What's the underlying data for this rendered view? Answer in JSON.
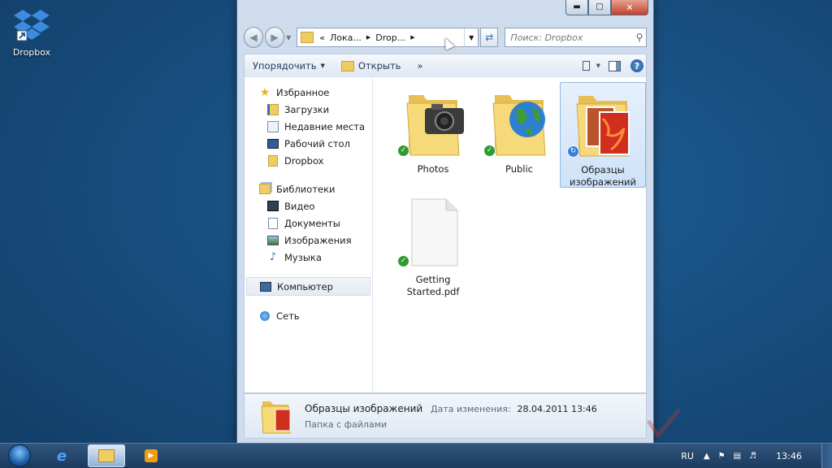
{
  "desktop": {
    "icon_label": "Dropbox"
  },
  "window": {
    "address": {
      "prefix": "«",
      "crumbs": [
        "Лока...",
        "Drop..."
      ]
    },
    "search_placeholder": "Поиск: Dropbox",
    "toolbar": {
      "organize": "Упорядочить",
      "open": "Открыть",
      "more": "»"
    },
    "navpane": {
      "favorites": {
        "title": "Избранное",
        "items": [
          "Загрузки",
          "Недавние места",
          "Рабочий стол",
          "Dropbox"
        ]
      },
      "libraries": {
        "title": "Библиотеки",
        "items": [
          "Видео",
          "Документы",
          "Изображения",
          "Музыка"
        ]
      },
      "computer": "Компьютер",
      "network": "Сеть"
    },
    "files": [
      {
        "name": "Photos",
        "status": "synced"
      },
      {
        "name": "Public",
        "status": "synced"
      },
      {
        "name": "Образцы изображений",
        "status": "syncing"
      },
      {
        "name": "Getting Started.pdf",
        "status": "synced"
      }
    ],
    "details": {
      "name": "Образцы изображений",
      "modified_label": "Дата изменения:",
      "modified_value": "28.04.2011 13:46",
      "type": "Папка с файлами"
    }
  },
  "taskbar": {
    "lang": "RU",
    "clock": "13:46"
  },
  "colors": {
    "folder": "#f0cd63",
    "synced": "#2f9a2f",
    "syncing": "#3b7ed6",
    "selection": "#cfe2f8"
  }
}
